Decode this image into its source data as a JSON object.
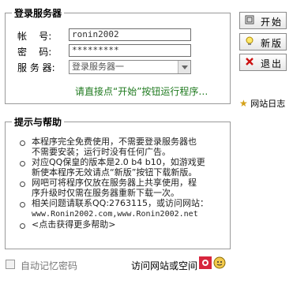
{
  "login": {
    "legend": "登录服务器",
    "account_label": "帐    号:",
    "account_value": "ronin2002",
    "password_label": "密    码:",
    "password_value": "*********",
    "server_label": "服 务 器:",
    "server_value": "登录服务器一",
    "hint": "请直接点“开始”按钮运行程序…"
  },
  "buttons": {
    "start": "开始",
    "new": "新版",
    "exit": "退出"
  },
  "site_log": "网站日志",
  "help": {
    "legend": "提示与帮助",
    "lines": [
      "本程序完全免费使用，不需要登录服务器也",
      "不需要安装；运行时没有任何广告。",
      "对应QQ保皇的版本是2.0 b4 b10，如游戏更",
      "新使本程序无效请点“新版”按钮下载新版。",
      "网吧可将程序仅放在服务器上共享使用，程",
      "序升级时仅需在服务器重新下载一次。",
      "相关问题请联系QQ:2763115，或访问网站：",
      "www.Ronin2002.com,www.Ronin2002.net",
      "<点击获得更多帮助>"
    ]
  },
  "footer": {
    "remember": "自动记忆密码",
    "visit": "访问网站或空间"
  },
  "colors": {
    "hint_green": "#1f7a1f",
    "exit_red": "#cc1111",
    "border_gray": "#9a9a9a"
  }
}
